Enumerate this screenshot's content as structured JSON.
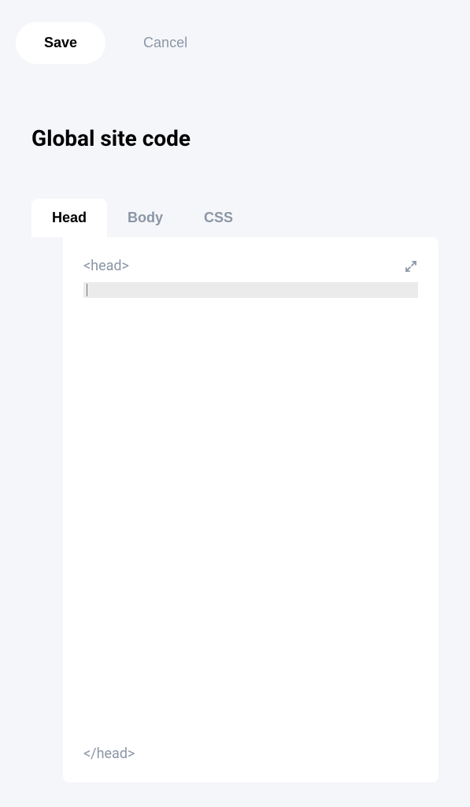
{
  "toolbar": {
    "save_label": "Save",
    "cancel_label": "Cancel"
  },
  "page": {
    "title": "Global site code"
  },
  "tabs": [
    {
      "label": "Head",
      "active": true
    },
    {
      "label": "Body",
      "active": false
    },
    {
      "label": "CSS",
      "active": false
    }
  ],
  "editor": {
    "open_tag": "<head>",
    "close_tag": "</head>",
    "content": ""
  }
}
